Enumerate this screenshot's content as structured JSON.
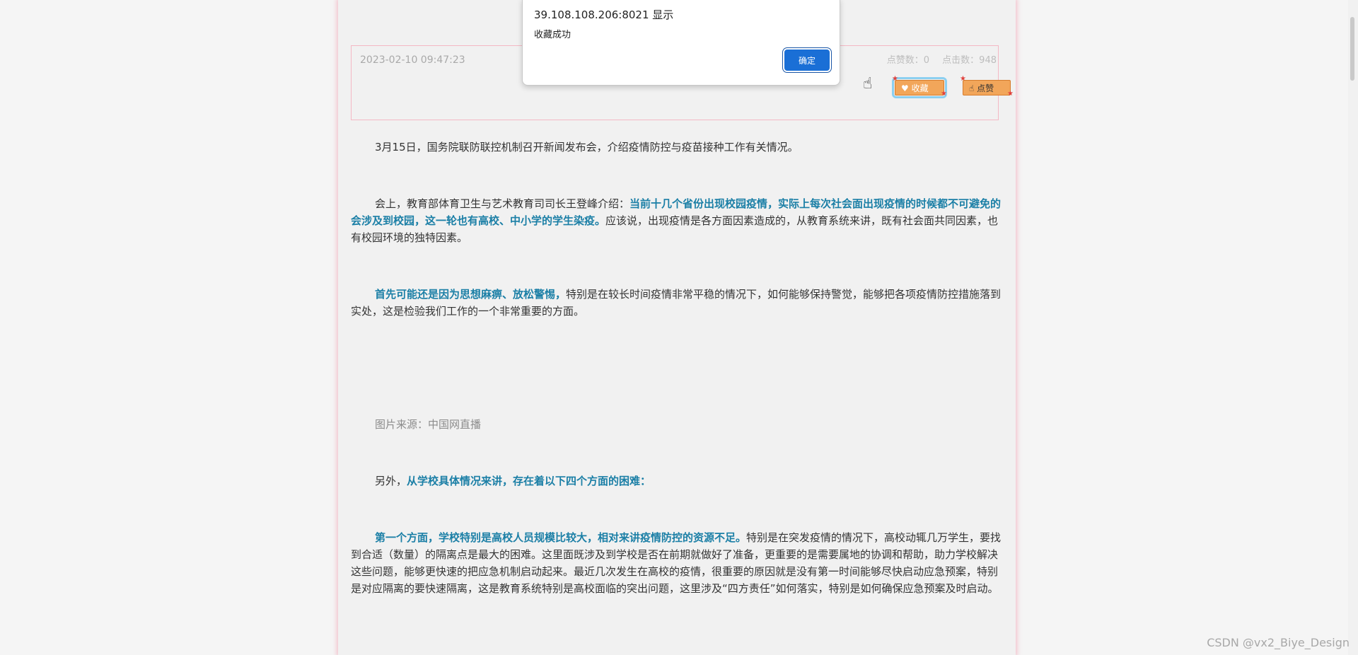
{
  "dialog": {
    "title": "39.108.108.206:8021 显示",
    "message": "收藏成功",
    "ok_label": "确定"
  },
  "meta": {
    "date": "2023-02-10 09:47:23",
    "likes_label": "点赞数：0",
    "clicks_label": "点击数：948",
    "favorite_label": "收藏",
    "like_label": "点赞"
  },
  "article": {
    "p1": "3月15日，国务院联防联控机制召开新闻发布会，介绍疫情防控与疫苗接种工作有关情况。",
    "p2_a": "会上，教育部体育卫生与艺术教育司司长王登峰介绍：",
    "p2_hl": "当前十几个省份出现校园疫情，实际上每次社会面出现疫情的时候都不可避免的会涉及到校园，这一轮也有高校、中小学的学生染疫。",
    "p2_b": "应该说，出现疫情是各方面因素造成的，从教育系统来讲，既有社会面共同因素，也有校园环境的独特因素。",
    "p3_hl": "首先可能还是因为思想麻痹、放松警惕，",
    "p3_b": "特别是在较长时间疫情非常平稳的情况下，如何能够保持警觉，能够把各项疫情防控措施落到实处，这是检验我们工作的一个非常重要的方面。",
    "caption": "图片来源：中国网直播",
    "p4_a": "另外，",
    "p4_hl": "从学校具体情况来讲，存在着以下四个方面的困难：",
    "p5_hl": "第一个方面，学校特别是高校人员规模比较大，相对来讲疫情防控的资源不足。",
    "p5_b": "特别是在突发疫情的情况下，高校动辄几万学生，要找到合适（数量）的隔离点是最大的困难。这里面既涉及到学校是否在前期就做好了准备，更重要的是需要属地的协调和帮助，助力学校解决这些问题，能够更快速的把应急机制启动起来。最近几次发生在高校的疫情，很重要的原因就是没有第一时间能够尽快启动应急预案，特别是对应隔离的要快速隔离，这是教育系统特别是高校面临的突出问题，这里涉及“四方责任”如何落实，特别是如何确保应急预案及时启动。"
  },
  "watermark": "CSDN @vx2_Biye_Design",
  "colors": {
    "highlight": "#1b7fa6",
    "ok_button": "#1a6fd6",
    "tag_button": "#f2a65a"
  },
  "icons": {
    "favorite": "heart-icon",
    "like": "thumbs-up-icon",
    "cursor": "hand-pointer-icon"
  }
}
